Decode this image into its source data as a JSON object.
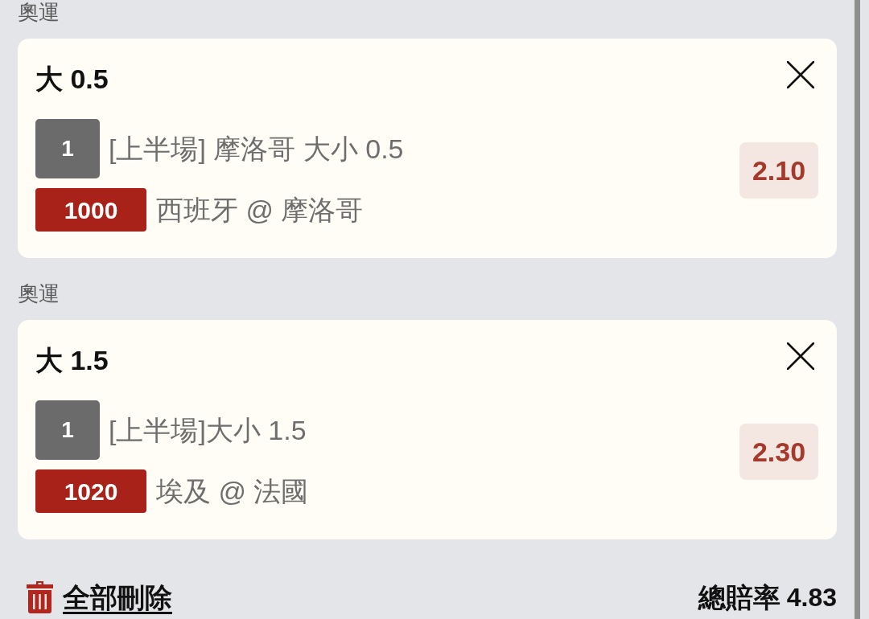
{
  "sections": [
    {
      "league": "奧運",
      "selection": {
        "title": "大 0.5",
        "leg": "1",
        "market": "[上半場] 摩洛哥 大小 0.5",
        "match_code": "1000",
        "match": "西班牙 @ 摩洛哥",
        "odds": "2.10"
      }
    },
    {
      "league": "奧運",
      "selection": {
        "title": "大 1.5",
        "leg": "1",
        "market": "[上半場]大小 1.5",
        "match_code": "1020",
        "match": "埃及 @ 法國",
        "odds": "2.30"
      }
    }
  ],
  "footer": {
    "clear_all": "全部刪除",
    "total_label": "總賠率",
    "total_value": "4.83"
  }
}
